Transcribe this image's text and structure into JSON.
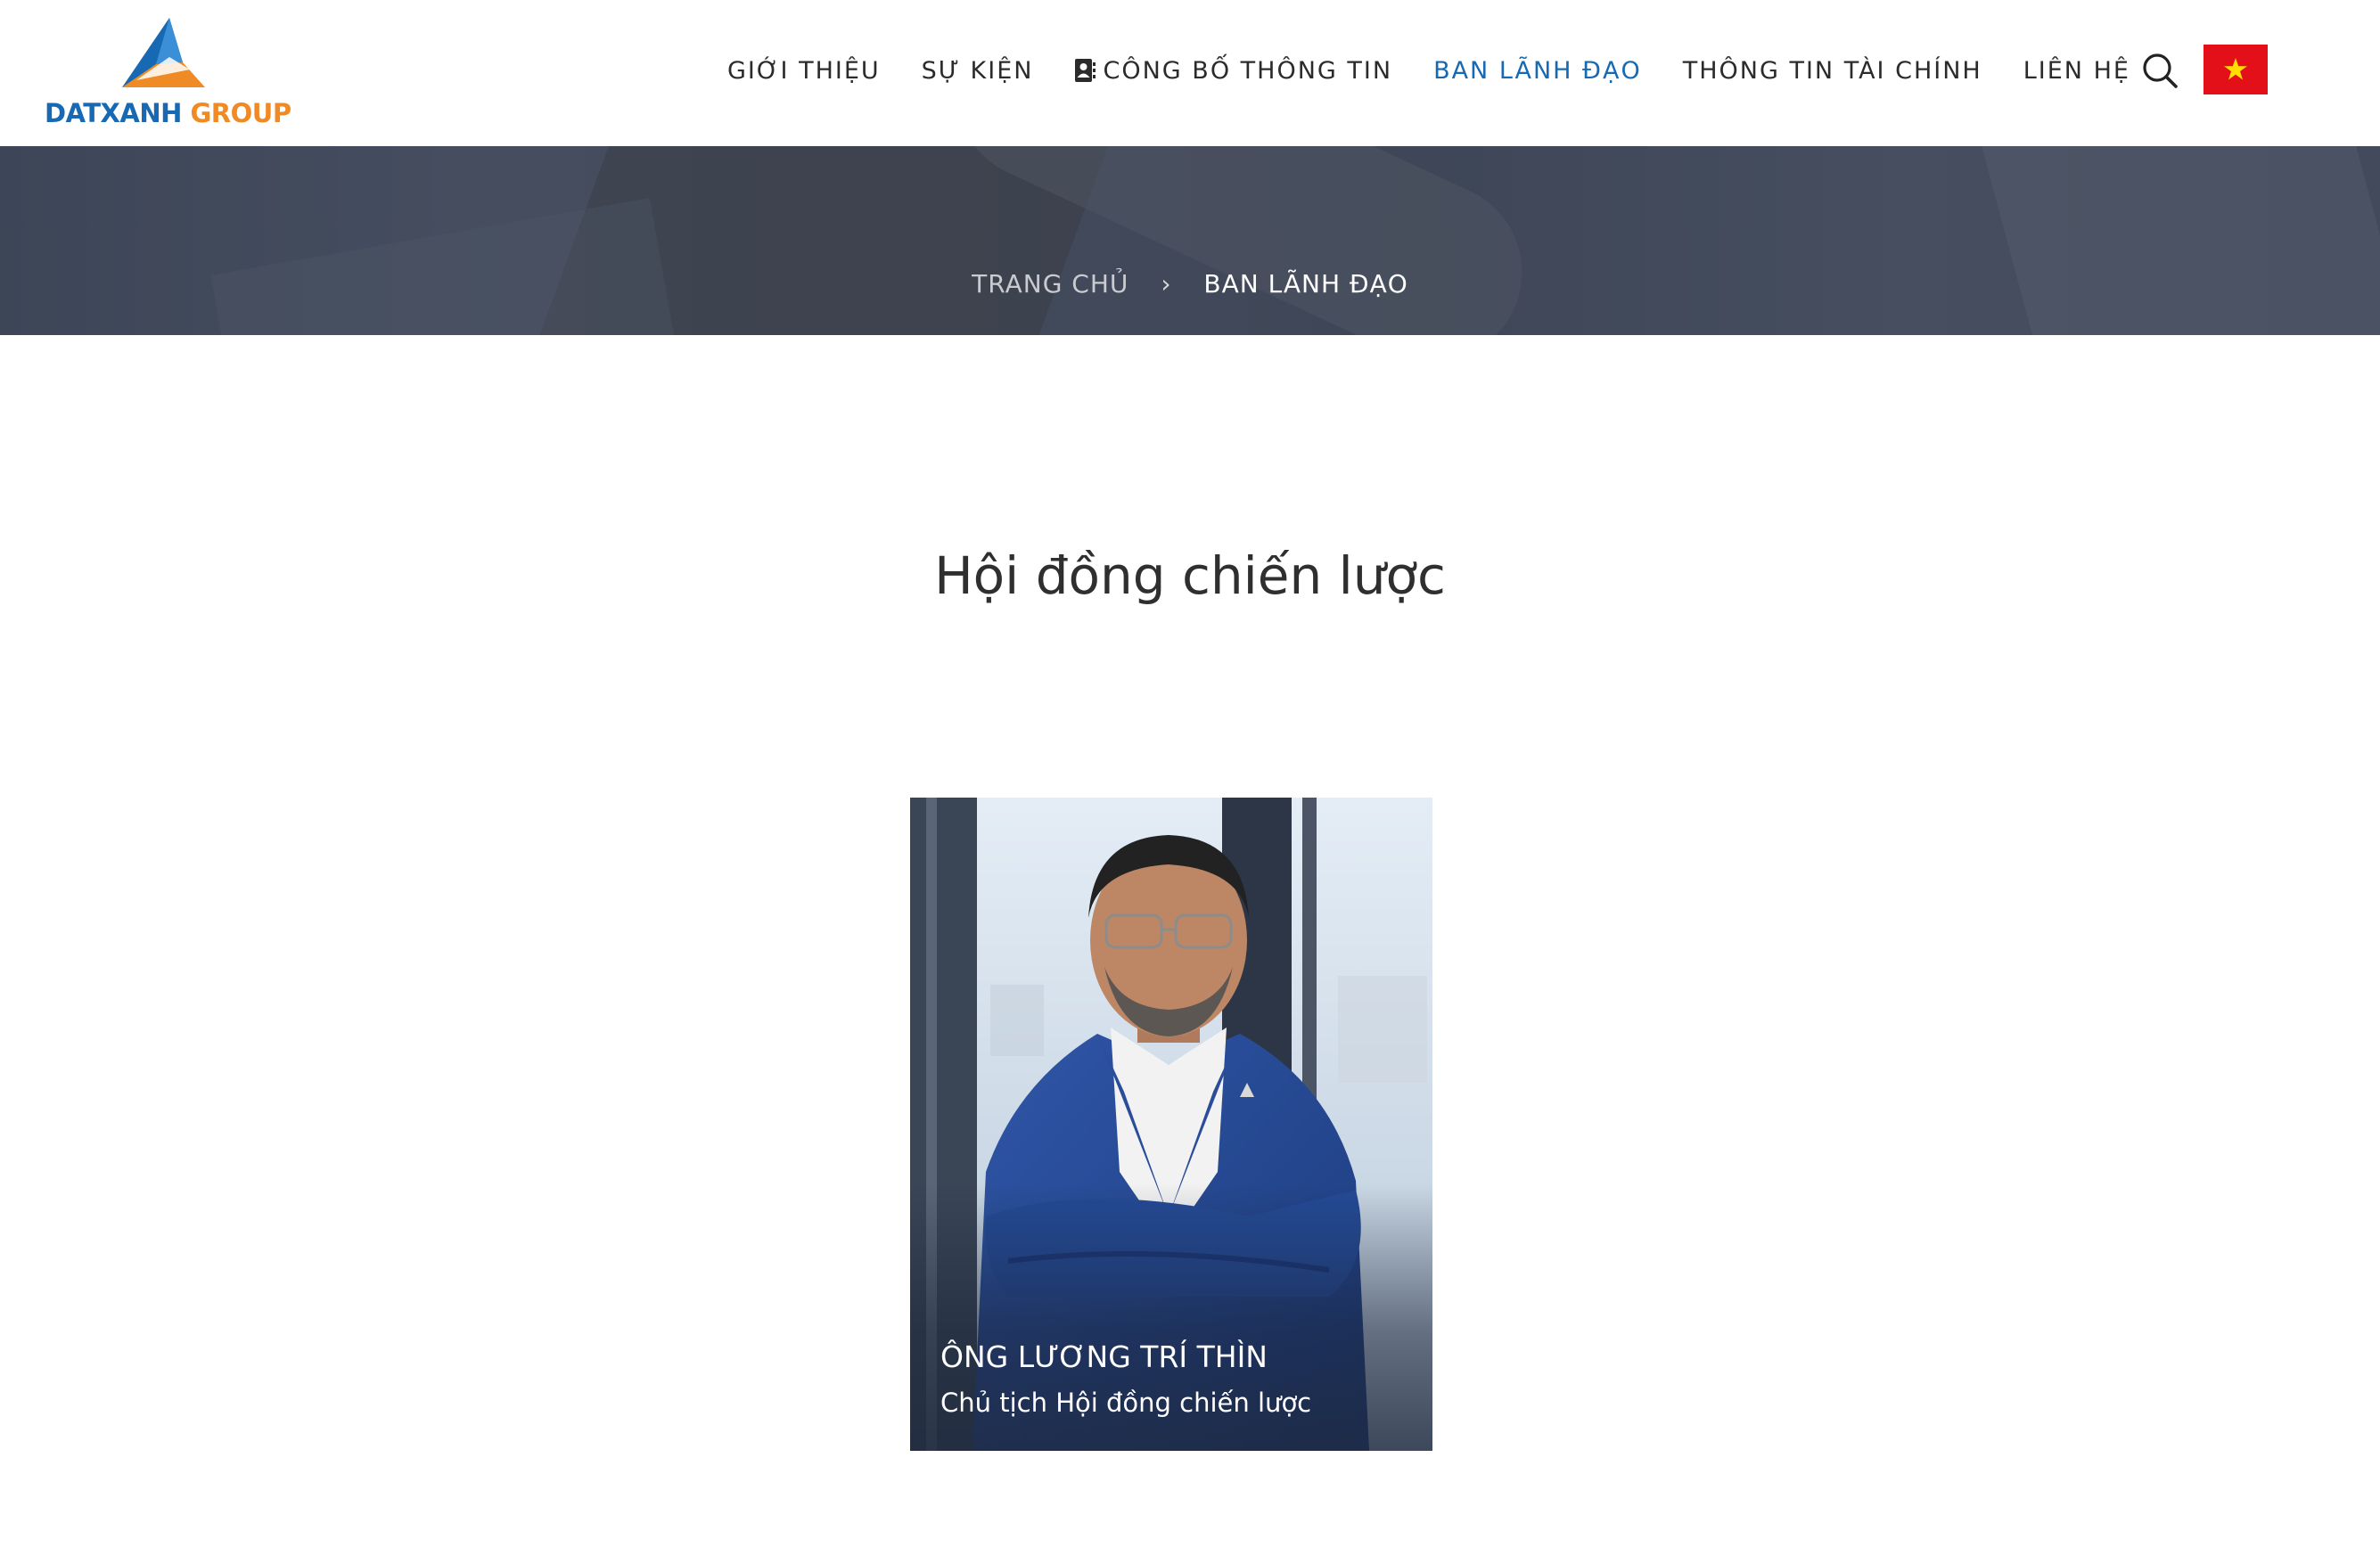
{
  "brand": {
    "name_primary": "DATXANH",
    "name_secondary": "GROUP",
    "color_primary": "#1669b2",
    "color_secondary": "#f08a24"
  },
  "nav": {
    "items": [
      {
        "label": "GIỚI THIỆU"
      },
      {
        "label": "SỰ KIỆN"
      },
      {
        "label": "CÔNG BỐ THÔNG TIN",
        "icon": "contact-book-icon"
      },
      {
        "label": "BAN LÃNH ĐẠO",
        "active": true
      },
      {
        "label": "THÔNG TIN TÀI CHÍNH"
      },
      {
        "label": "LIÊN HỆ"
      }
    ],
    "active_color": "#1669b2",
    "search_icon": "search-icon",
    "language_flag": "vietnam-flag-icon"
  },
  "breadcrumb": {
    "home": "TRANG CHỦ",
    "separator": "›",
    "current": "BAN LÃNH ĐẠO"
  },
  "main": {
    "section_title": "Hội đồng chiến lược",
    "members": [
      {
        "name": "ÔNG LƯƠNG TRÍ THÌN",
        "role": "Chủ tịch Hội đồng chiến lược"
      }
    ]
  }
}
